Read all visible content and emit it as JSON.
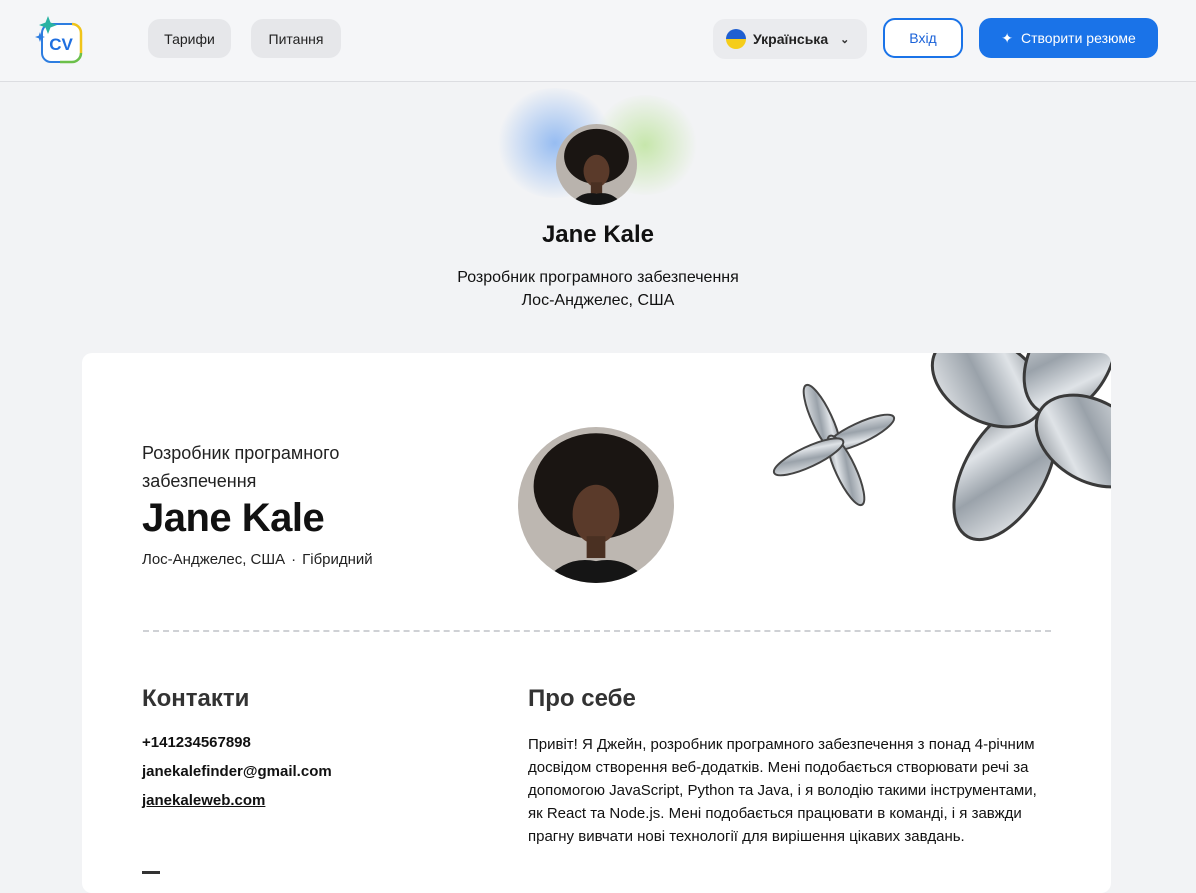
{
  "header": {
    "logo_text": "CV",
    "nav": {
      "pricing": "Тарифи",
      "faq": "Питання"
    },
    "language": {
      "selected": "Українська",
      "flag_icon": "ukraine-flag-icon"
    },
    "login_label": "Вхід",
    "create_label": "Створити резюме",
    "accent_color": "#1a73e8"
  },
  "hero": {
    "name": "Jane Kale",
    "role": "Розробник програмного забезпечення",
    "location": "Лос-Анджелес, США"
  },
  "card": {
    "role": "Розробник програмного забезпечення",
    "name": "Jane Kale",
    "location": "Лос-Анджелес, США",
    "work_mode": "Гібридний",
    "contacts": {
      "title": "Контакти",
      "phone": "+141234567898",
      "email": "janekalefinder@gmail.com",
      "website": "janekaleweb.com"
    },
    "about": {
      "title": "Про себе",
      "text": "Привіт! Я Джейн, розробник програмного забезпечення з понад 4-річним досвідом створення веб-додатків. Мені подобається створювати речі за допомогою JavaScript, Python та Java, і я володію такими інструментами, як React та Node.js. Мені подобається працювати в команді, і я завжди прагну вивчати нові технології для вирішення цікавих завдань."
    }
  }
}
